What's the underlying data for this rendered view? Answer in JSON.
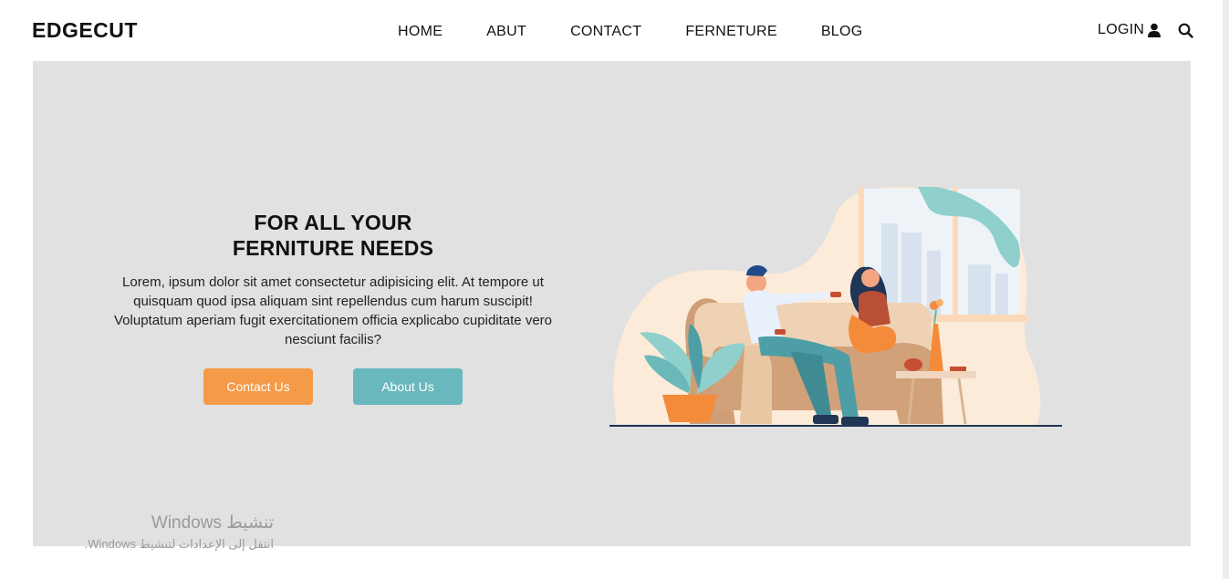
{
  "nav": {
    "brand": "EDGECUT",
    "links": [
      "HOME",
      "ABUT",
      "CONTACT",
      "FERNETURE",
      "BLOG"
    ],
    "login": "LOGIN",
    "user_icon": "user-icon",
    "search_icon": "search-icon"
  },
  "hero": {
    "title_line1": "FOR ALL YOUR",
    "title_line2": "FERNITURE NEEDS",
    "text": "Lorem, ipsum dolor sit amet consectetur adipisicing elit. At tempore ut quisquam quod ipsa aliquam sint repellendus cum harum suscipit! Voluptatum aperiam fugit exercitationem officia explicabo cupiditate vero nesciunt facilis?",
    "contact_button": "Contact Us",
    "about_button": "About Us"
  },
  "watermark": {
    "title": "تنشيط Windows",
    "subtitle": "انتقل إلى الإعدادات لتنشيط Windows."
  },
  "colors": {
    "hero_bg": "#e1e1e1",
    "contact_btn": "#f59a46",
    "about_btn": "#69b8be"
  }
}
